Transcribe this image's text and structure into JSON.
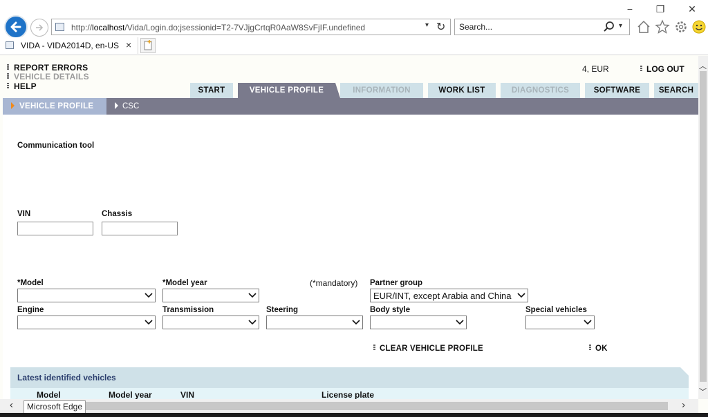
{
  "browser": {
    "url_prefix": "http://",
    "url_host": "localhost",
    "url_path": "/Vida/Login.do;jsessionid=T2-7VJjgCrtqR0AaW8SvFjIF.undefined",
    "search_placeholder": "Search...",
    "tab_title": "VIDA - VIDA2014D, en-US",
    "tab_close": "×",
    "minimize": "−",
    "restore": "❐",
    "close": "✕",
    "edge_tooltip": "Microsoft Edge"
  },
  "header": {
    "links": [
      {
        "label": "REPORT ERRORS",
        "enabled": true
      },
      {
        "label": "VEHICLE DETAILS",
        "enabled": false
      },
      {
        "label": "HELP",
        "enabled": true
      }
    ],
    "user_info": "4, EUR",
    "logout": "LOG OUT"
  },
  "main_tabs": [
    {
      "label": "START",
      "state": "normal"
    },
    {
      "label": "VEHICLE PROFILE",
      "state": "active"
    },
    {
      "label": "INFORMATION",
      "state": "disabled"
    },
    {
      "label": "WORK LIST",
      "state": "normal"
    },
    {
      "label": "DIAGNOSTICS",
      "state": "disabled"
    },
    {
      "label": "SOFTWARE",
      "state": "normal"
    },
    {
      "label": "SEARCH",
      "state": "normal"
    }
  ],
  "sub_nav": {
    "active": "VEHICLE PROFILE",
    "other": "CSC"
  },
  "form": {
    "communication_tool_label": "Communication tool",
    "vin_label": "VIN",
    "vin_value": "",
    "chassis_label": "Chassis",
    "chassis_value": "",
    "model_label": "*Model",
    "model_value": "",
    "model_year_label": "*Model year",
    "model_year_value": "",
    "mandatory_note": "(*mandatory)",
    "partner_group_label": "Partner group",
    "partner_group_value": "EUR/INT, except Arabia and China",
    "engine_label": "Engine",
    "engine_value": "",
    "transmission_label": "Transmission",
    "transmission_value": "",
    "steering_label": "Steering",
    "steering_value": "",
    "body_style_label": "Body style",
    "body_style_value": "",
    "special_vehicles_label": "Special vehicles",
    "special_vehicles_value": "",
    "clear_label": "CLEAR VEHICLE PROFILE",
    "ok_label": "OK"
  },
  "latest": {
    "title": "Latest identified vehicles",
    "columns": [
      "Model",
      "Model year",
      "VIN",
      "License plate"
    ]
  },
  "colors": {
    "tab_bg": "#cfe1e8",
    "tab_active": "#7a7a8c",
    "subnav_active": "#a8b6d2",
    "accent_orange": "#f08a1c",
    "browser_back": "#1e73c8"
  }
}
